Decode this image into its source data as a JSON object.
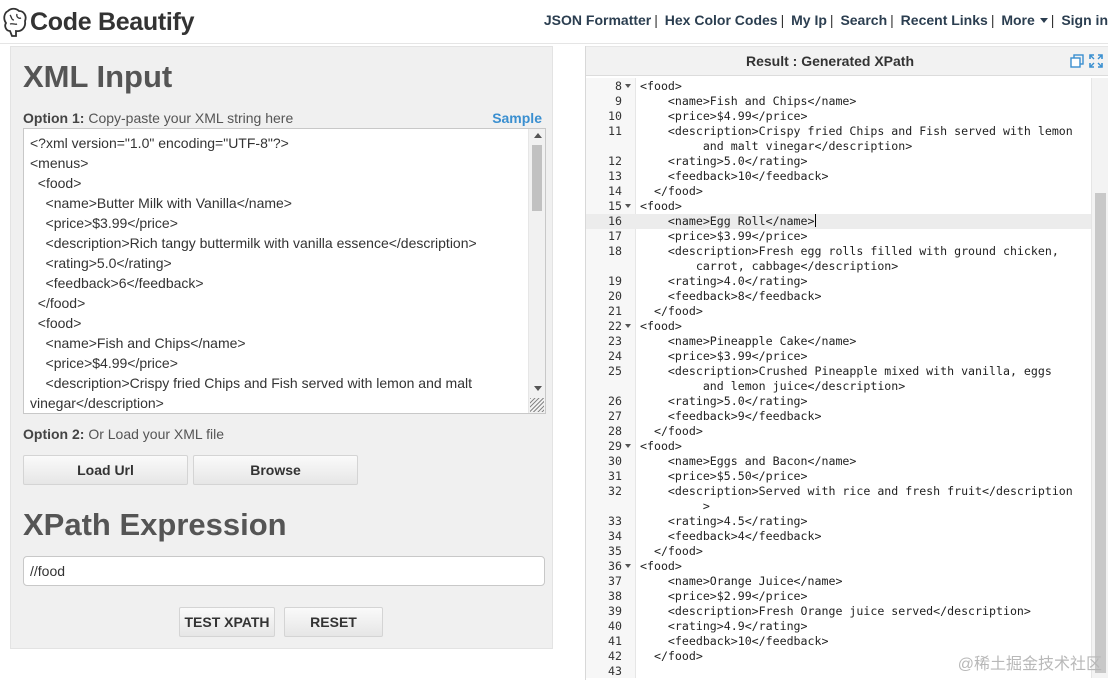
{
  "header": {
    "logo_text": "Code Beautify",
    "nav": [
      {
        "label": "JSON Formatter"
      },
      {
        "label": "Hex Color Codes"
      },
      {
        "label": "My Ip"
      },
      {
        "label": "Search"
      },
      {
        "label": "Recent Links"
      },
      {
        "label": "More"
      },
      {
        "label": "Sign in"
      }
    ]
  },
  "left": {
    "xml_title": "XML Input",
    "option1_bold": "Option 1:",
    "option1_text": " Copy-paste your XML string here",
    "sample_link": "Sample",
    "xml_lines": [
      "<?xml version=\"1.0\" encoding=\"UTF-8\"?>",
      "<menus>",
      "  <food>",
      "    <name>Butter Milk with Vanilla</name>",
      "    <price>$3.99</price>",
      "    <description>Rich tangy buttermilk with vanilla essence</description>",
      "    <rating>5.0</rating>",
      "    <feedback>6</feedback>",
      "  </food>",
      "  <food>",
      "    <name>Fish and Chips</name>",
      "    <price>$4.99</price>",
      "    <description>Crispy fried Chips and Fish served with lemon and malt",
      "vinegar</description>"
    ],
    "option2_bold": "Option 2:",
    "option2_text": " Or Load your XML file",
    "load_url_button": "Load Url",
    "browse_button": "Browse",
    "xpath_title": "XPath Expression",
    "xpath_value": "//food",
    "test_button": "TEST XPATH",
    "reset_button": "RESET"
  },
  "right": {
    "title": "Result : Generated XPath",
    "active_line": 16,
    "lines": [
      {
        "n": "8",
        "fold": true,
        "text": "<food>"
      },
      {
        "n": "9",
        "fold": false,
        "text": "    <name>Fish and Chips</name>"
      },
      {
        "n": "10",
        "fold": false,
        "text": "    <price>$4.99</price>"
      },
      {
        "n": "11",
        "fold": false,
        "text": "    <description>Crispy fried Chips and Fish served with lemon"
      },
      {
        "n": "",
        "fold": false,
        "text": "         and malt vinegar</description>"
      },
      {
        "n": "12",
        "fold": false,
        "text": "    <rating>5.0</rating>"
      },
      {
        "n": "13",
        "fold": false,
        "text": "    <feedback>10</feedback>"
      },
      {
        "n": "14",
        "fold": false,
        "text": "  </food>"
      },
      {
        "n": "15",
        "fold": true,
        "text": "<food>"
      },
      {
        "n": "16",
        "fold": false,
        "text": "    <name>Egg Roll</name>"
      },
      {
        "n": "17",
        "fold": false,
        "text": "    <price>$3.99</price>"
      },
      {
        "n": "18",
        "fold": false,
        "text": "    <description>Fresh egg rolls filled with ground chicken,"
      },
      {
        "n": "",
        "fold": false,
        "text": "        carrot, cabbage</description>"
      },
      {
        "n": "19",
        "fold": false,
        "text": "    <rating>4.0</rating>"
      },
      {
        "n": "20",
        "fold": false,
        "text": "    <feedback>8</feedback>"
      },
      {
        "n": "21",
        "fold": false,
        "text": "  </food>"
      },
      {
        "n": "22",
        "fold": true,
        "text": "<food>"
      },
      {
        "n": "23",
        "fold": false,
        "text": "    <name>Pineapple Cake</name>"
      },
      {
        "n": "24",
        "fold": false,
        "text": "    <price>$3.99</price>"
      },
      {
        "n": "25",
        "fold": false,
        "text": "    <description>Crushed Pineapple mixed with vanilla, eggs"
      },
      {
        "n": "",
        "fold": false,
        "text": "         and lemon juice</description>"
      },
      {
        "n": "26",
        "fold": false,
        "text": "    <rating>5.0</rating>"
      },
      {
        "n": "27",
        "fold": false,
        "text": "    <feedback>9</feedback>"
      },
      {
        "n": "28",
        "fold": false,
        "text": "  </food>"
      },
      {
        "n": "29",
        "fold": true,
        "text": "<food>"
      },
      {
        "n": "30",
        "fold": false,
        "text": "    <name>Eggs and Bacon</name>"
      },
      {
        "n": "31",
        "fold": false,
        "text": "    <price>$5.50</price>"
      },
      {
        "n": "32",
        "fold": false,
        "text": "    <description>Served with rice and fresh fruit</description"
      },
      {
        "n": "",
        "fold": false,
        "text": "         >"
      },
      {
        "n": "33",
        "fold": false,
        "text": "    <rating>4.5</rating>"
      },
      {
        "n": "34",
        "fold": false,
        "text": "    <feedback>4</feedback>"
      },
      {
        "n": "35",
        "fold": false,
        "text": "  </food>"
      },
      {
        "n": "36",
        "fold": true,
        "text": "<food>"
      },
      {
        "n": "37",
        "fold": false,
        "text": "    <name>Orange Juice</name>"
      },
      {
        "n": "38",
        "fold": false,
        "text": "    <price>$2.99</price>"
      },
      {
        "n": "39",
        "fold": false,
        "text": "    <description>Fresh Orange juice served</description>"
      },
      {
        "n": "40",
        "fold": false,
        "text": "    <rating>4.9</rating>"
      },
      {
        "n": "41",
        "fold": false,
        "text": "    <feedback>10</feedback>"
      },
      {
        "n": "42",
        "fold": false,
        "text": "  </food>"
      },
      {
        "n": "43",
        "fold": false,
        "text": ""
      }
    ]
  },
  "watermark": "@稀土掘金技术社区",
  "colors": {
    "accent": "#3a8fd0",
    "nav": "#2b3e50",
    "panel": "#f0f0f0"
  }
}
